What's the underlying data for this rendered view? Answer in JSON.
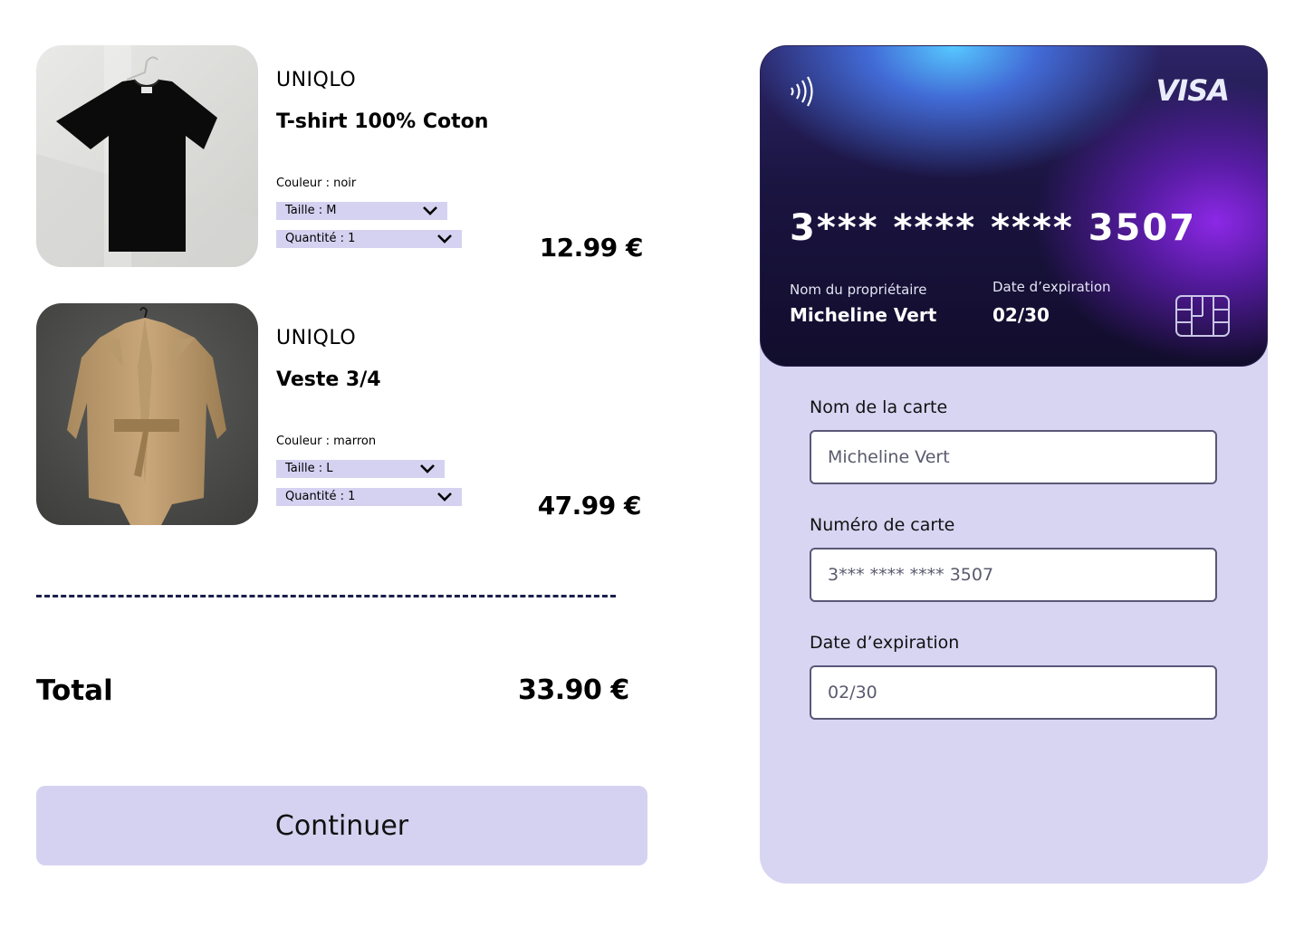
{
  "cart": {
    "items": [
      {
        "brand": "UNIQLO",
        "name": "T-shirt 100% Coton",
        "color_label": "Couleur : noir",
        "size_label": "Taille : M",
        "quantity_label": "Quantité : 1",
        "price": "12.99 €",
        "image_icon": "tshirt-photo"
      },
      {
        "brand": "UNIQLO",
        "name": "Veste 3/4",
        "color_label": "Couleur : marron",
        "size_label": "Taille : L",
        "quantity_label": "Quantité : 1",
        "price": "47.99 €",
        "image_icon": "jacket-photo"
      }
    ],
    "total_label": "Total",
    "total_value": "33.90 €",
    "continue_label": "Continuer"
  },
  "card": {
    "brand": "VISA",
    "number": "3*** **** **** 3507",
    "holder_label": "Nom du propriétaire",
    "holder_name": "Micheline Vert",
    "expiry_label": "Date d’expiration",
    "expiry_value": "02/30",
    "nfc_icon": "contactless-icon",
    "chip_icon": "chip-icon"
  },
  "form": {
    "card_name_label": "Nom de la carte",
    "card_name_value": "Micheline Vert",
    "card_number_label": "Numéro de carte",
    "card_number_value": "3*** **** **** 3507",
    "expiry_label": "Date d’expiration",
    "expiry_value": "02/30"
  },
  "colors": {
    "accent_lavender": "#d5d2f1",
    "panel_bg": "#d8d5f3",
    "divider": "#1b1f4a"
  }
}
